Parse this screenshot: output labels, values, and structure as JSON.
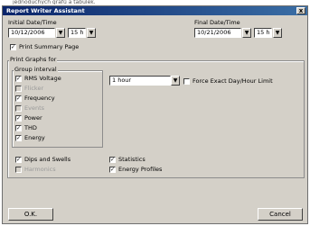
{
  "caption": "jednoduchých grafů a tabulek.",
  "window": {
    "title": "Report Writer Assistant",
    "close": "x"
  },
  "initial": {
    "label": "Initial Date/Time",
    "date": "10/12/2006",
    "hour": "15 h"
  },
  "final": {
    "label": "Final Date/Time",
    "date": "10/21/2006",
    "hour": "15 h"
  },
  "summary": {
    "label": "Print Summary Page",
    "checked": true
  },
  "graphs": {
    "label": "Print Graphs for",
    "group_label": "Group interval",
    "interval_value": "1 hour",
    "force_label": "Force Exact Day/Hour Limit",
    "items": [
      {
        "label": "RMS Voltage",
        "checked": true,
        "enabled": true
      },
      {
        "label": "Flicker",
        "checked": false,
        "enabled": false
      },
      {
        "label": "Frequency",
        "checked": true,
        "enabled": true
      },
      {
        "label": "Events",
        "checked": false,
        "enabled": false
      },
      {
        "label": "Power",
        "checked": true,
        "enabled": true
      },
      {
        "label": "THD",
        "checked": true,
        "enabled": true
      },
      {
        "label": "Energy",
        "checked": true,
        "enabled": true
      }
    ]
  },
  "bottom": {
    "dips": {
      "label": "Dips and Swells",
      "checked": true
    },
    "harmonics": {
      "label": "Harmonics",
      "checked": false
    },
    "statistics": {
      "label": "Statistics",
      "checked": true
    },
    "energy_profiles": {
      "label": "Energy Profiles",
      "checked": true
    }
  },
  "buttons": {
    "ok": "O.K.",
    "cancel": "Cancel"
  }
}
